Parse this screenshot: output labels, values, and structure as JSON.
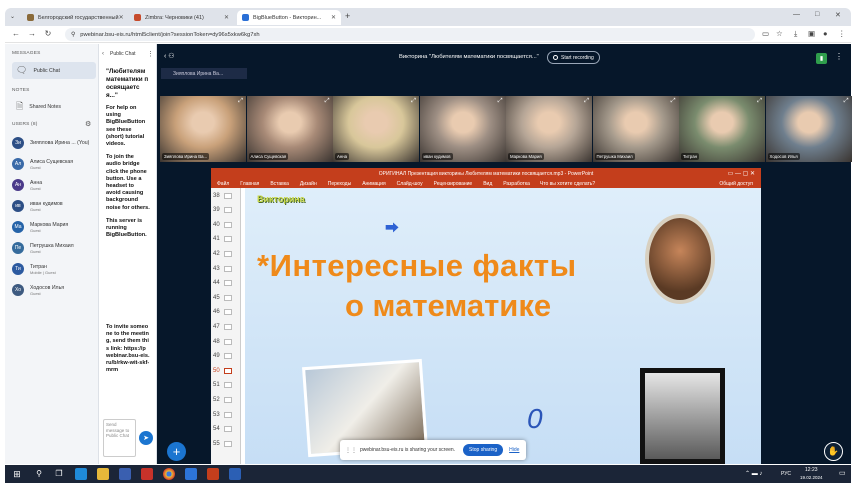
{
  "browser": {
    "tabs": [
      {
        "label": "Белгородский государственный",
        "active": false
      },
      {
        "label": "Zimbra: Черновики (41)",
        "active": false
      },
      {
        "label": "BigBlueButton - Викторин...",
        "active": true
      }
    ],
    "url": "pwebinar.bsu-eis.ru/html5client/join?sessionToken=dy96s5xkw6kg7xh"
  },
  "left": {
    "messages_header": "MESSAGES",
    "public_chat": "Public Chat",
    "notes_header": "NOTES",
    "shared_notes": "Shared Notes",
    "users_header": "USERS (8)",
    "users": [
      {
        "initials": "Зи",
        "name": "Зияплова Ирина ... (You)",
        "role": "",
        "color": "#2d4f86"
      },
      {
        "initials": "Ал",
        "name": "Алиса Сущевская",
        "role": "Guest",
        "color": "#3a6aa8"
      },
      {
        "initials": "Ан",
        "name": "Анна",
        "role": "Guest",
        "color": "#4b3a8a"
      },
      {
        "initials": "ив",
        "name": "иван кудимов",
        "role": "Guest",
        "color": "#2d4f86"
      },
      {
        "initials": "Ма",
        "name": "Маркова Мария",
        "role": "Guest",
        "color": "#2563a8"
      },
      {
        "initials": "Пе",
        "name": "Петрушка Михаил",
        "role": "Guest",
        "color": "#356b9c"
      },
      {
        "initials": "Ти",
        "name": "Титран",
        "role": "Mobile | Guest",
        "color": "#2c5aa0"
      },
      {
        "initials": "Хо",
        "name": "Ходосов Илья",
        "role": "Guest",
        "color": "#3d5a80"
      }
    ]
  },
  "chat": {
    "header": "Public Chat",
    "welcome": "\"Любителям математики посвящается...\"",
    "help_text": "For help on using BigBlueButton see these (short) tutorial videos.",
    "audio_text": "To join the audio bridge click the phone button. Use a headset to avoid causing background noise for others.",
    "server_text": "This server is running BigBlueButton.",
    "invite_text": "To invite someone to the meeting, send them this link: https://pwebinar.bsu-eis.ru/b/rkw-wit-skf-mrm",
    "input_placeholder": "Send message to Public Chat"
  },
  "meeting": {
    "title": "Викторина \"Любителям математики посвящается...\"",
    "recording_label": "Start recording",
    "presenter_bar": "Зияплова Ирина Ва..."
  },
  "videos": [
    {
      "name": "Зияплова Ирина Ва...",
      "bg": "#c9a17a"
    },
    {
      "name": "Алиса Сущевская",
      "bg": "#a88a77"
    },
    {
      "name": "Анна",
      "bg": "#d8c79a"
    },
    {
      "name": "иван кудимов",
      "bg": "#9e8f84"
    },
    {
      "name": "Маркова Мария",
      "bg": "#b5a596"
    },
    {
      "name": "Петрушка Михаил",
      "bg": "#a59a8c"
    },
    {
      "name": "Титран",
      "bg": "#7a8c6e"
    },
    {
      "name": "Ходосов Илья",
      "bg": "#6f7f8e"
    }
  ],
  "ppt": {
    "title": "ОРИГИНАЛ Презентация викторины Любителям математики посвящается.mp3 - PowerPoint",
    "ribbon": [
      "Файл",
      "Главная",
      "Вставка",
      "Дизайн",
      "Переходы",
      "Анимация",
      "Слайд-шоу",
      "Рецензирование",
      "Вид",
      "Разработка"
    ],
    "search": "Что вы хотите сделать?",
    "share": "Общий доступ",
    "slides": [
      "38",
      "39",
      "40",
      "41",
      "42",
      "43",
      "44",
      "45",
      "46",
      "47",
      "48",
      "49",
      "50",
      "51",
      "52",
      "53",
      "54",
      "55"
    ],
    "slide_label": "Викторина",
    "slide_title_line1": "*Интересные факты",
    "slide_title_line2": "о математике",
    "slide_zero": "0"
  },
  "share_bar": {
    "text": "pwebinar.bsu-eis.ru is sharing your screen.",
    "stop": "Stop sharing",
    "hide": "Hide"
  },
  "taskbar": {
    "lang": "РУС",
    "time": "12:23",
    "date": "19.02.2024"
  }
}
